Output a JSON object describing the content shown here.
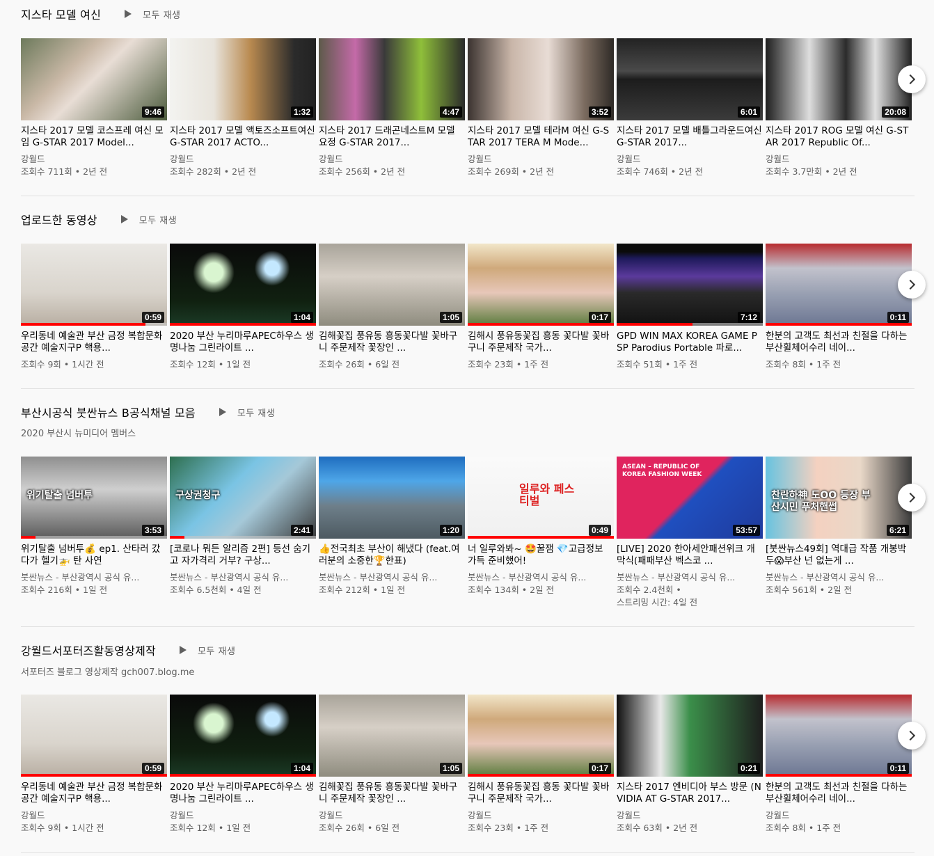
{
  "shelves": [
    {
      "title": "지스타 모델 여신",
      "play_all": "모두 재생",
      "subtitle": "",
      "videos": [
        {
          "title": "지스타 2017 모델 코스프레 여신 모임 G-STAR 2017 Model...",
          "channel": "강월드",
          "stats": "조회수 711회 • 2년 전",
          "duration": "9:46",
          "art": "a1",
          "progress": 0
        },
        {
          "title": "지스타 2017 모델 액토즈소프트여신 G-STAR 2017 ACTO...",
          "channel": "강월드",
          "stats": "조회수 282회 • 2년 전",
          "duration": "1:32",
          "art": "a2",
          "progress": 0
        },
        {
          "title": "지스타 2017 드래곤네스트M 모델 요정 G-STAR 2017...",
          "channel": "강월드",
          "stats": "조회수 256회 • 2년 전",
          "duration": "4:47",
          "art": "a3",
          "progress": 0
        },
        {
          "title": "지스타 2017 모델 테라M 여신 G-STAR 2017 TERA M Mode...",
          "channel": "강월드",
          "stats": "조회수 269회 • 2년 전",
          "duration": "3:52",
          "art": "a4",
          "progress": 0
        },
        {
          "title": "지스타 2017 모델 배틀그라운드여신 G-STAR 2017...",
          "channel": "강월드",
          "stats": "조회수 746회 • 2년 전",
          "duration": "6:01",
          "art": "a5",
          "progress": 0
        },
        {
          "title": "지스타 2017 ROG 모델 여신 G-STAR 2017 Republic Of...",
          "channel": "강월드",
          "stats": "조회수 3.7만회 • 2년 전",
          "duration": "20:08",
          "art": "a6",
          "progress": 0
        }
      ]
    },
    {
      "title": "업로드한 동영상",
      "play_all": "모두 재생",
      "subtitle": "",
      "videos": [
        {
          "title": "우리동네 예술관 부산 금정 복합문화공간 예술지구P 핵용...",
          "channel": "",
          "stats": "조회수 9회 • 1시간 전",
          "duration": "0:59",
          "art": "b1",
          "progress": 0.85
        },
        {
          "title": "2020 부산 누리마루APEC하우스 생명나눔 그린라이트 ...",
          "channel": "",
          "stats": "조회수 12회 • 1일 전",
          "duration": "1:04",
          "art": "b2",
          "progress": 1
        },
        {
          "title": "김해꽃집 풍유동 흥동꽃다발 꽃바구니 주문제작 꽃장인 ...",
          "channel": "",
          "stats": "조회수 26회 • 6일 전",
          "duration": "1:05",
          "art": "b3",
          "progress": 0
        },
        {
          "title": "김해시 풍유동꽃집 흥동 꽃다발 꽃바구니 주문제작 국가...",
          "channel": "",
          "stats": "조회수 23회 • 1주 전",
          "duration": "0:17",
          "art": "b4",
          "progress": 1
        },
        {
          "title": "GPD WIN MAX KOREA GAME PSP Parodius Portable 파로...",
          "channel": "",
          "stats": "조회수 51회 • 1주 전",
          "duration": "7:12",
          "art": "b5",
          "progress": 0.52
        },
        {
          "title": "한분의 고객도 최선과 친절을 다하는 부산휠체어수리 네이...",
          "channel": "",
          "stats": "조회수 8회 • 1주 전",
          "duration": "0:11",
          "art": "b6",
          "progress": 1
        }
      ]
    },
    {
      "title": "부산시공식 붓싼뉴스 B공식채널 모음",
      "play_all": "모두 재생",
      "subtitle": "2020 부산시 뉴미디어 멤버스",
      "videos": [
        {
          "title": "위기탈출 넘버투💰 ep1. 산타러 갔다가 헬기🚁 탄 사연",
          "channel": "붓싼뉴스 - 부산광역시 공식 유...",
          "stats": "조회수 216회 • 1일 전",
          "stats2": "",
          "duration": "3:53",
          "art": "c1",
          "progress": 0.1,
          "overlay": "위기탈출 넘버투"
        },
        {
          "title": "[코로나 뭐든 알리즘 2편] 등선 숨기고 자가격리 거부? 구상...",
          "channel": "붓싼뉴스 - 부산광역시 공식 유...",
          "stats": "조회수 6.5천회 • 4일 전",
          "stats2": "",
          "duration": "2:41",
          "art": "c2",
          "progress": 0.1,
          "overlay": "구상권청구"
        },
        {
          "title": "👍전국최초 부산이 해냈다 (feat.여러분의 소중한🏆한표)",
          "channel": "붓싼뉴스 - 부산광역시 공식 유...",
          "stats": "조회수 212회 • 1일 전",
          "stats2": "",
          "duration": "1:20",
          "art": "c3",
          "progress": 0
        },
        {
          "title": "너 일루와봐~ 🤩꿀잼 💎고급정보 가득 준비했어!",
          "channel": "붓싼뉴스 - 부산광역시 공식 유...",
          "stats": "조회수 134회 • 2일 전",
          "stats2": "",
          "duration": "0:49",
          "art": "c4",
          "progress": 1,
          "overlay": "일루와 페스티벌"
        },
        {
          "title": "[LIVE] 2020 한아세안패션위크 개막식(패패부산 벡스코 ...",
          "channel": "붓싼뉴스 - 부산광역시 공식 유...",
          "stats": "조회수 2.4천회 •",
          "stats2": "스트리밍 시간: 4일 전",
          "duration": "53:57",
          "art": "c5",
          "progress": 0,
          "overlay": "ASEAN – REPUBLIC OF KOREA FASHION WEEK"
        },
        {
          "title": "[붓싼뉴스49회] 역대급 작품 개봉박두😱부산 넌 없는게 ...",
          "channel": "붓싼뉴스 - 부산광역시 공식 유...",
          "stats": "조회수 561회 • 2일 전",
          "stats2": "",
          "duration": "6:21",
          "art": "c6",
          "progress": 0,
          "overlay": "찬란하神 도OO 등장 부산시민 푸처핸썹"
        }
      ]
    },
    {
      "title": "강월드서포터즈활동영상제작",
      "play_all": "모두 재생",
      "subtitle": "서포터즈 블로그 영상제작 gch007.blog.me",
      "videos": [
        {
          "title": "우리동네 예술관 부산 금정 복합문화공간 예술지구P 핵용...",
          "channel": "강월드",
          "stats": "조회수 9회 • 1시간 전",
          "duration": "0:59",
          "art": "b1",
          "progress": 1
        },
        {
          "title": "2020 부산 누리마루APEC하우스 생명나눔 그린라이트 ...",
          "channel": "강월드",
          "stats": "조회수 12회 • 1일 전",
          "duration": "1:04",
          "art": "b2",
          "progress": 1
        },
        {
          "title": "김해꽃집 풍유동 흥동꽃다발 꽃바구니 주문제작 꽃장인 ...",
          "channel": "강월드",
          "stats": "조회수 26회 • 6일 전",
          "duration": "1:05",
          "art": "b3",
          "progress": 0
        },
        {
          "title": "김해시 풍유동꽃집 흥동 꽃다발 꽃바구니 주문제작 국가...",
          "channel": "강월드",
          "stats": "조회수 23회 • 1주 전",
          "duration": "0:17",
          "art": "b4",
          "progress": 1
        },
        {
          "title": "지스타 2017 엔비디아 부스 방문 (NVIDIA AT G-STAR 2017...",
          "channel": "강월드",
          "stats": "조회수 63회 • 2년 전",
          "duration": "0:21",
          "art": "d5",
          "progress": 0
        },
        {
          "title": "한분의 고객도 최선과 친절을 다하는 부산휠체어수리 네이...",
          "channel": "강월드",
          "stats": "조회수 8회 • 1주 전",
          "duration": "0:11",
          "art": "b6",
          "progress": 1
        }
      ]
    }
  ],
  "icons": {
    "play_all": "play-triangle-icon",
    "next": "chevron-right-icon"
  },
  "colors": {
    "progress": "#ff0000",
    "background": "#f9f9f9",
    "secondary_text": "#606060"
  }
}
